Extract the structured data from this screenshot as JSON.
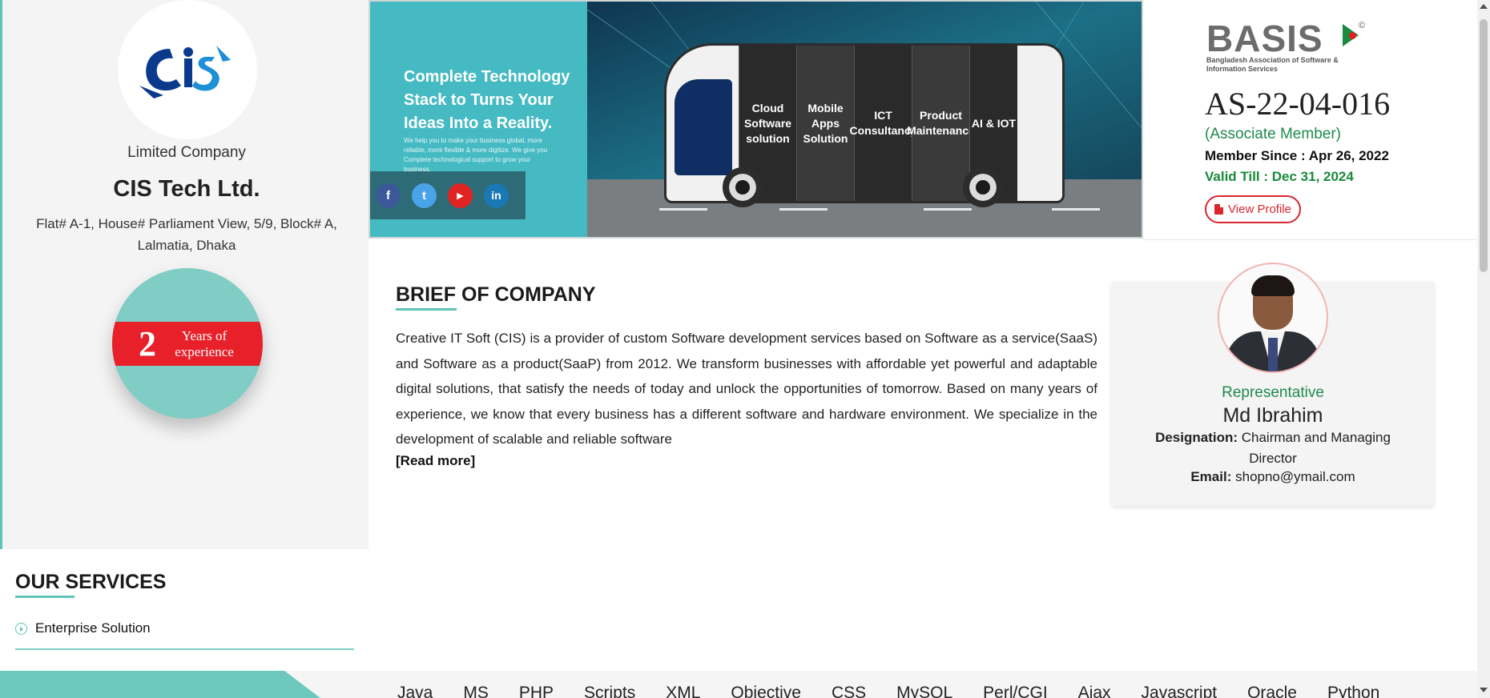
{
  "company": {
    "logo_text": "CIS",
    "type": "Limited Company",
    "name": "CIS Tech Ltd.",
    "address": "Flat# A-1, House# Parliament View, 5/9, Block# A, Lalmatia, Dhaka",
    "experience_years": "2",
    "experience_label": "Years of experience"
  },
  "banner": {
    "headline": "Complete Technology Stack to Turns Your Ideas Into a Reality.",
    "subtext": "We help you to make your business global, more reliable, more flexible & more digitize. We give you Complete technological support to grow your business.",
    "social": [
      {
        "icon": "facebook-icon",
        "glyph": "f"
      },
      {
        "icon": "twitter-icon",
        "glyph": "t"
      },
      {
        "icon": "youtube-icon",
        "glyph": "▶"
      },
      {
        "icon": "linkedin-icon",
        "glyph": "in"
      }
    ],
    "bus_panels": [
      "Cloud Software solution",
      "Mobile Apps Solution",
      "ICT Consultancy",
      "Product Maintenance",
      "AI & IOT"
    ]
  },
  "membership": {
    "logo_word": "BASIS",
    "logo_sub": "Bangladesh Association of Software & Information Services",
    "logo_reg": "©",
    "number": "AS-22-04-016",
    "type": "(Associate Member)",
    "since": "Member Since : Apr 26, 2022",
    "valid_till": "Valid Till : Dec 31, 2024",
    "view_profile_label": "View Profile"
  },
  "brief": {
    "title": "BRIEF OF COMPANY",
    "text": "Creative IT Soft (CIS) is a provider of custom Software development services based on Software as a service(SaaS) and Software as a product(SaaP) from 2012. We transform businesses with affordable yet powerful and adaptable digital solutions, that satisfy the needs of today and unlock the opportunities of tomorrow. Based on many years of experience, we know that every business has a different software and hardware environment. We specialize in the development of scalable and reliable software",
    "read_more": "[Read more]"
  },
  "representative": {
    "role": "Representative",
    "name": "Md Ibrahim",
    "designation_label": "Designation:",
    "designation": "Chairman and Managing Director",
    "email_label": "Email:",
    "email": "shopno@ymail.com"
  },
  "services": {
    "title": "OUR SERVICES",
    "items": [
      "Enterprise Solution"
    ]
  },
  "technologies": [
    "Java",
    "MS",
    "PHP",
    "Scripts",
    "XML",
    "Objective",
    "CSS",
    "MySQL",
    "Perl/CGI",
    "Ajax",
    "Javascript",
    "Oracle",
    "Python"
  ],
  "colors": {
    "accent": "#5fc4b8",
    "banner_teal": "#46bac3",
    "badge_red": "#e8202a",
    "green": "#1f8a4c",
    "view_profile_red": "#d8272f"
  }
}
